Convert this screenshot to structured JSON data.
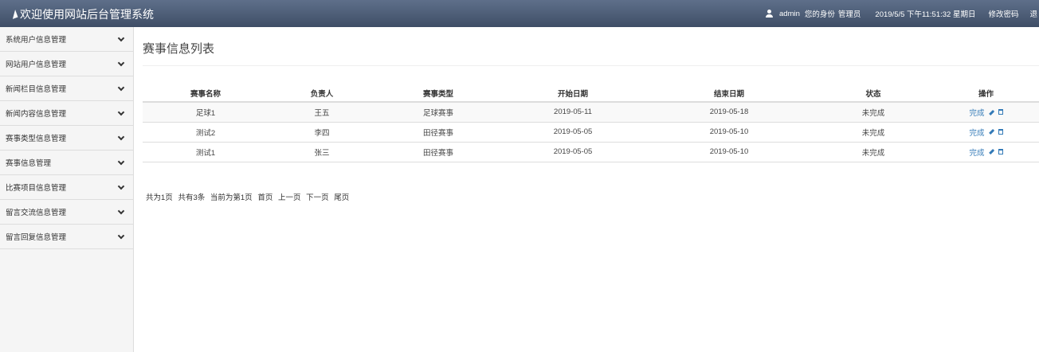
{
  "header": {
    "brand": "欢迎使用网站后台管理系统",
    "username": "admin",
    "identity_label": "您的身份",
    "identity_value": "管理员",
    "datetime": "2019/5/5 下午11:51:32 星期日",
    "change_password": "修改密码",
    "logout": "退"
  },
  "sidebar": {
    "items": [
      {
        "label": "系统用户信息管理"
      },
      {
        "label": "网站用户信息管理"
      },
      {
        "label": "新闻栏目信息管理"
      },
      {
        "label": "新闻内容信息管理"
      },
      {
        "label": "赛事类型信息管理"
      },
      {
        "label": "赛事信息管理"
      },
      {
        "label": "比赛项目信息管理"
      },
      {
        "label": "留言交流信息管理"
      },
      {
        "label": "留言回复信息管理"
      }
    ]
  },
  "main": {
    "title": "赛事信息列表",
    "columns": [
      "赛事名称",
      "负责人",
      "赛事类型",
      "开始日期",
      "结束日期",
      "状态",
      "操作"
    ],
    "rows": [
      {
        "name": "足球1",
        "owner": "王五",
        "type": "足球赛事",
        "start": "2019-05-11",
        "end": "2019-05-18",
        "status": "未完成",
        "action": "完成"
      },
      {
        "name": "测试2",
        "owner": "李四",
        "type": "田径赛事",
        "start": "2019-05-05",
        "end": "2019-05-10",
        "status": "未完成",
        "action": "完成"
      },
      {
        "name": "测试1",
        "owner": "张三",
        "type": "田径赛事",
        "start": "2019-05-05",
        "end": "2019-05-10",
        "status": "未完成",
        "action": "完成"
      }
    ],
    "pager": {
      "total_pages": "共为1页",
      "total_records": "共有3条",
      "current": "当前为第1页",
      "first": "首页",
      "prev": "上一页",
      "next": "下一页",
      "last": "尾页"
    }
  },
  "icons": {
    "brand": "send-icon",
    "user": "user-icon",
    "expand": "chevron-down-icon",
    "edit": "pencil-icon",
    "delete": "trash-icon"
  },
  "colors": {
    "topbar": "#4a5a74",
    "link": "#337ab7"
  }
}
